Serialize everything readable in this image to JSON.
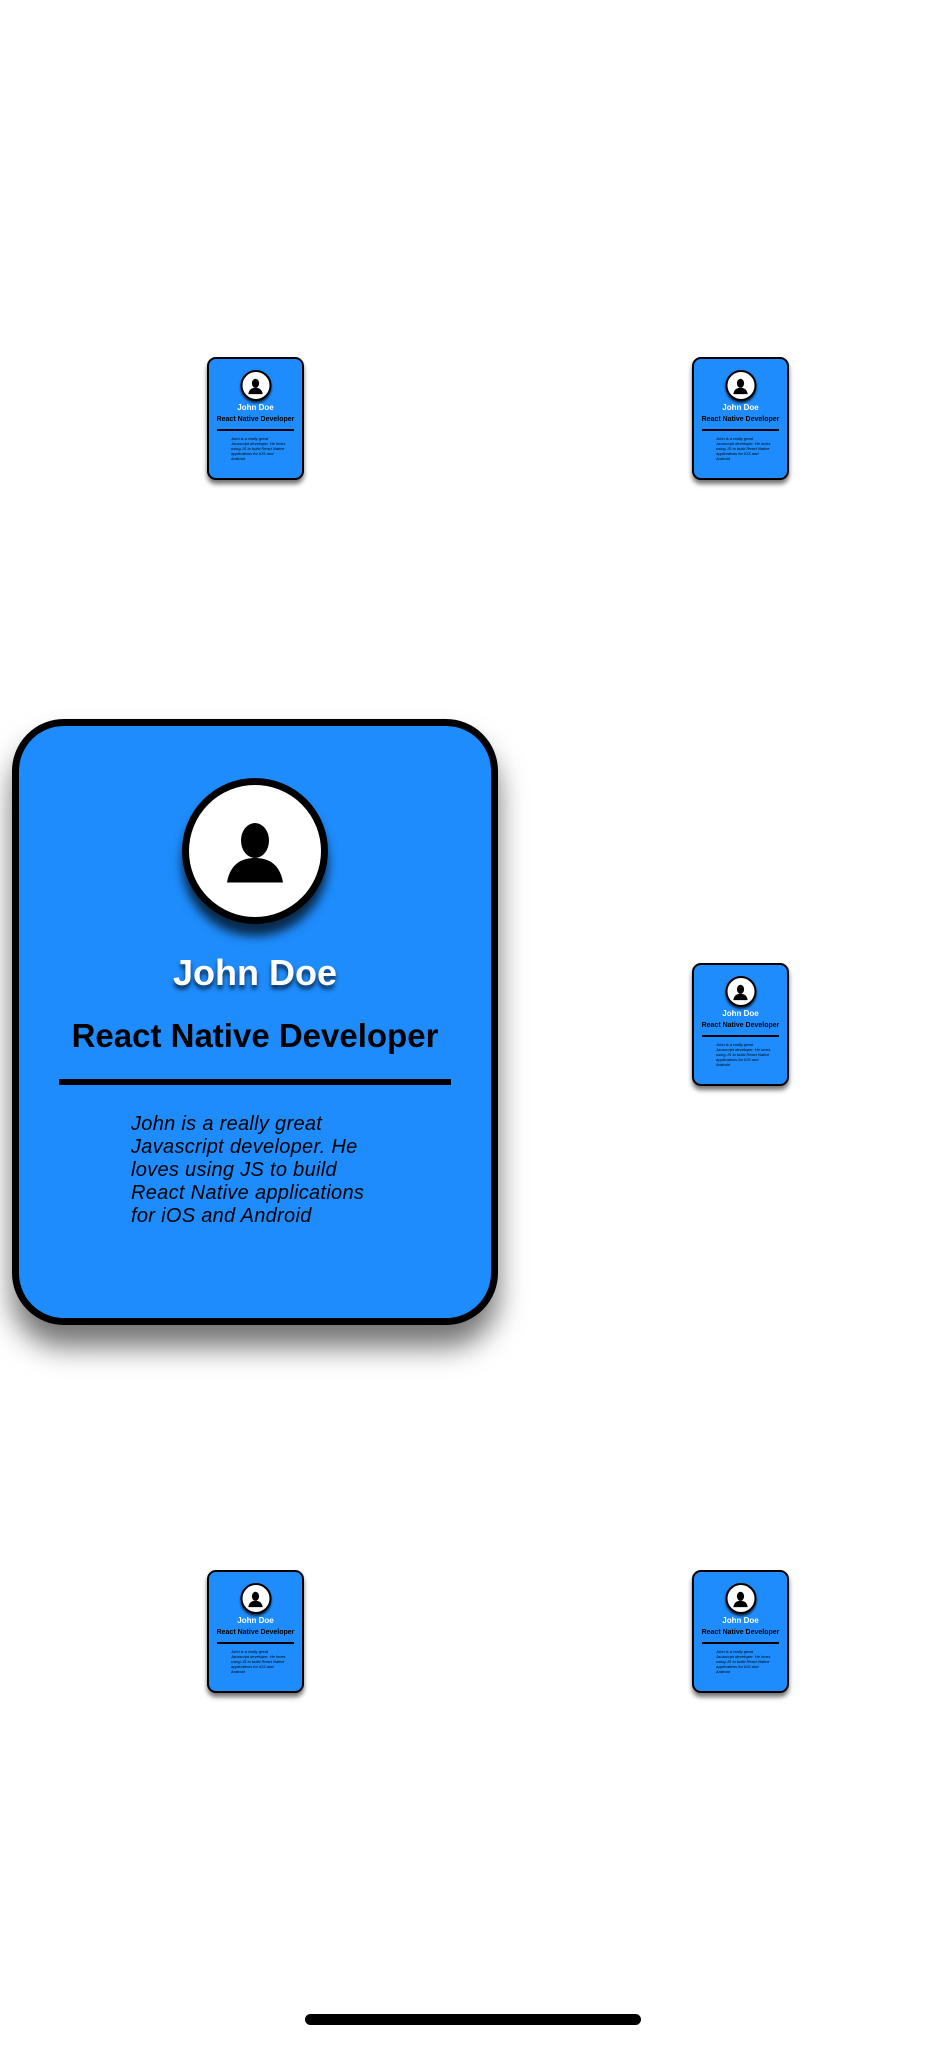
{
  "card": {
    "name": "John Doe",
    "role": "React Native Developer",
    "bio": "John is a really great Javascript developer. He loves using JS to build React Native applications for iOS and Android",
    "avatar_icon": "user-silhouette-icon",
    "background_color": "#1e8cfd",
    "border_color": "#000000"
  },
  "mini_cards": [
    {
      "name": "John Doe",
      "role": "React Native Developer",
      "bio": "John is a really great Javascript developer. He loves using JS to build React Native applications for iOS and Android"
    },
    {
      "name": "John Doe",
      "role": "React Native Developer",
      "bio": "John is a really great Javascript developer. He loves using JS to build React Native applications for iOS and Android"
    },
    {
      "name": "John Doe",
      "role": "React Native Developer",
      "bio": "John is a really great Javascript developer. He loves using JS to build React Native applications for iOS and Android"
    },
    {
      "name": "John Doe",
      "role": "React Native Developer",
      "bio": "John is a really great Javascript developer. He loves using JS to build React Native applications for iOS and Android"
    },
    {
      "name": "John Doe",
      "role": "React Native Developer",
      "bio": "John is a really great Javascript developer. He loves using JS to build React Native applications for iOS and Android"
    }
  ],
  "system": {
    "home_indicator_icon": "home-indicator"
  }
}
